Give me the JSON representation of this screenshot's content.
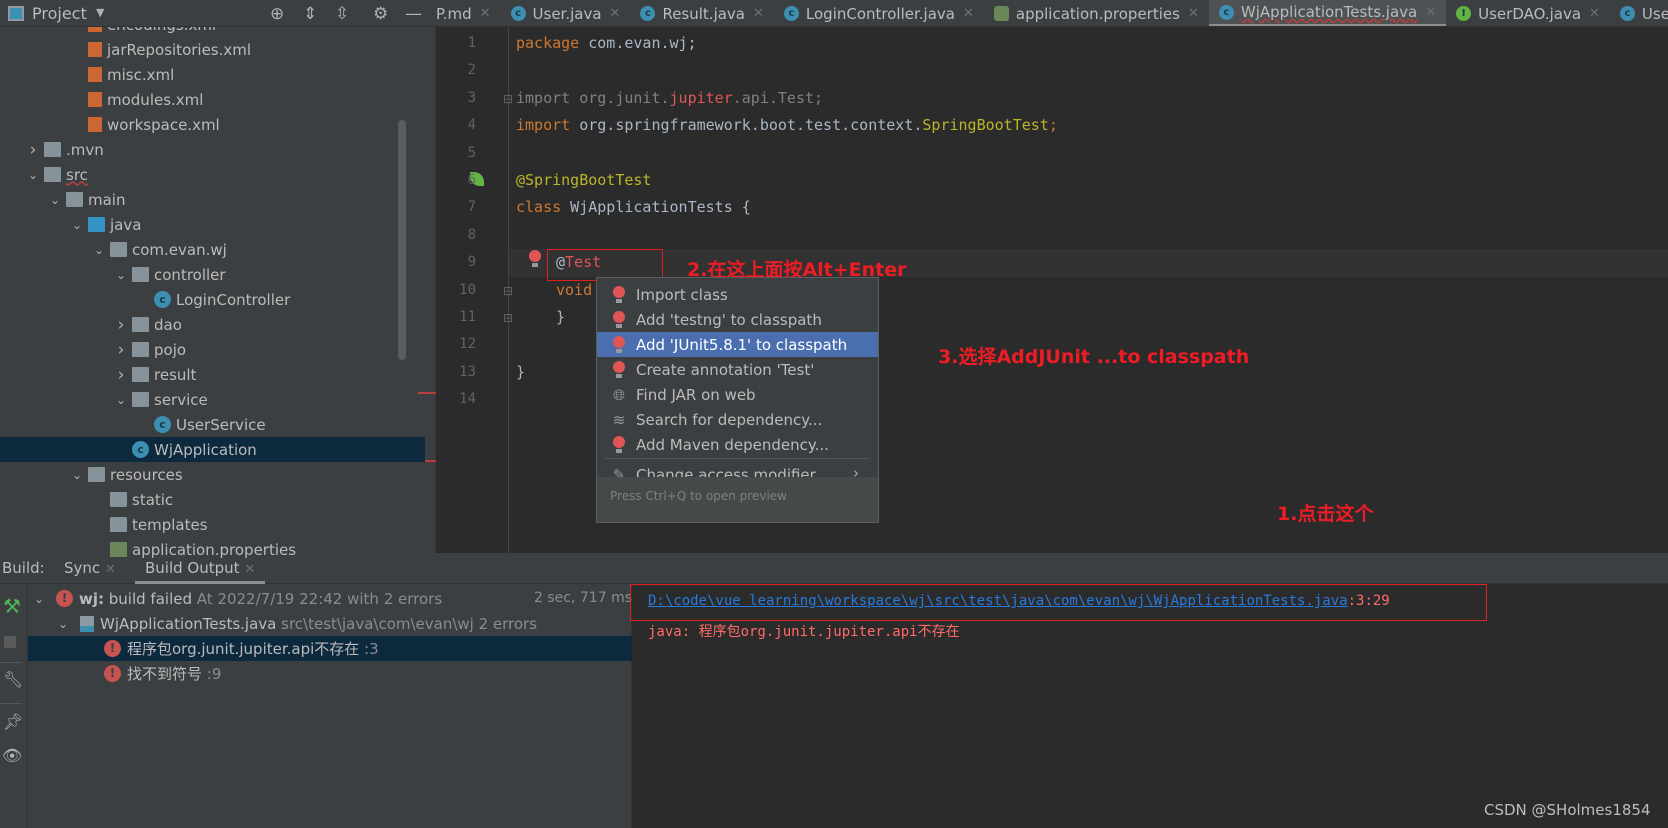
{
  "project_panel": {
    "title": "Project",
    "tree": [
      {
        "label": "encodings.xml",
        "depth": 3,
        "icon": "xml-file-icon"
      },
      {
        "label": "jarRepositories.xml",
        "depth": 3,
        "icon": "xml-file-icon"
      },
      {
        "label": "misc.xml",
        "depth": 3,
        "icon": "xml-file-icon"
      },
      {
        "label": "modules.xml",
        "depth": 3,
        "icon": "xml-file-icon"
      },
      {
        "label": "workspace.xml",
        "depth": 3,
        "icon": "xml-file-icon"
      },
      {
        "label": ".mvn",
        "depth": 1,
        "icon": "folder-icon",
        "chevron": "right"
      },
      {
        "label": "src",
        "depth": 1,
        "icon": "folder-icon",
        "chevron": "down"
      },
      {
        "label": "main",
        "depth": 2,
        "icon": "folder-icon",
        "chevron": "down"
      },
      {
        "label": "java",
        "depth": 3,
        "icon": "source-folder-icon",
        "chevron": "down"
      },
      {
        "label": "com.evan.wj",
        "depth": 4,
        "icon": "package-icon",
        "chevron": "down"
      },
      {
        "label": "controller",
        "depth": 5,
        "icon": "package-icon",
        "chevron": "down"
      },
      {
        "label": "LoginController",
        "depth": 6,
        "icon": "class-icon"
      },
      {
        "label": "dao",
        "depth": 5,
        "icon": "package-icon",
        "chevron": "right"
      },
      {
        "label": "pojo",
        "depth": 5,
        "icon": "package-icon",
        "chevron": "right"
      },
      {
        "label": "result",
        "depth": 5,
        "icon": "package-icon",
        "chevron": "right"
      },
      {
        "label": "service",
        "depth": 5,
        "icon": "package-icon",
        "chevron": "down"
      },
      {
        "label": "UserService",
        "depth": 6,
        "icon": "class-icon"
      },
      {
        "label": "WjApplication",
        "depth": 5,
        "icon": "spring-app-class-icon",
        "selected": true
      },
      {
        "label": "resources",
        "depth": 3,
        "icon": "resources-folder-icon",
        "chevron": "down"
      },
      {
        "label": "static",
        "depth": 4,
        "icon": "folder-icon"
      },
      {
        "label": "templates",
        "depth": 4,
        "icon": "folder-icon"
      },
      {
        "label": "application.properties",
        "depth": 4,
        "icon": "properties-file-icon"
      }
    ]
  },
  "editor_tabs": [
    {
      "label": "P.md",
      "icon": "markdown-icon"
    },
    {
      "label": "User.java",
      "icon": "class-icon"
    },
    {
      "label": "Result.java",
      "icon": "class-icon"
    },
    {
      "label": "LoginController.java",
      "icon": "class-icon"
    },
    {
      "label": "application.properties",
      "icon": "spring-properties-icon"
    },
    {
      "label": "WjApplicationTests.java",
      "icon": "class-icon",
      "active": true
    },
    {
      "label": "UserDAO.java",
      "icon": "interface-icon"
    },
    {
      "label": "Use",
      "icon": "class-icon"
    }
  ],
  "code": {
    "line_numbers": [
      "1",
      "2",
      "3",
      "4",
      "5",
      "6",
      "7",
      "8",
      "9",
      "10",
      "11",
      "12",
      "13",
      "14"
    ],
    "l1_kw": "package",
    "l1_rest": " com.evan.wj;",
    "l3_kw": "import",
    "l3_a": " org.junit.",
    "l3_red": "jupiter",
    "l3_b": ".api.Test;",
    "l4_kw": "import",
    "l4_a": " org.springframework.boot.test.context.",
    "l4_an": "SpringBootTest",
    "l4_semi": ";",
    "l6": "@SpringBootTest",
    "l7_kw": "class",
    "l7_rest": " WjApplicationTests {",
    "l9_at": "@",
    "l9_red": "Test",
    "l10": "void",
    "l11": "}",
    "l13": "}"
  },
  "annotations": {
    "step1": "1.点击这个",
    "step2": "2.在这上面按Alt+Enter",
    "step3": "3.选择AddJUnit ...to classpath",
    "color": "#ee1c24"
  },
  "intention_popup": {
    "items": [
      {
        "label": "Import class",
        "icon": "error-bulb-icon"
      },
      {
        "label": "Add 'testng' to classpath",
        "icon": "error-bulb-icon"
      },
      {
        "label": "Add 'JUnit5.8.1' to classpath",
        "icon": "error-bulb-icon",
        "selected": true
      },
      {
        "label": "Create annotation 'Test'",
        "icon": "error-bulb-icon"
      },
      {
        "label": "Find JAR on web",
        "icon": "globe-icon"
      },
      {
        "label": "Search for dependency...",
        "icon": "layers-icon"
      },
      {
        "label": "Add Maven dependency...",
        "icon": "error-bulb-icon"
      }
    ],
    "submenu_item": "Change access modifier",
    "footer": "Press Ctrl+Q to open preview"
  },
  "build_panel": {
    "label": "Build:",
    "tabs": [
      "Sync",
      "Build Output"
    ],
    "active_tab": "Build Output",
    "root": {
      "name": "wj:",
      "status": "build failed",
      "detail": "At 2022/7/19 22:42 with 2 errors",
      "duration": "2 sec, 717 ms"
    },
    "file": {
      "name": "WjApplicationTests.java",
      "path": "src\\test\\java\\com\\evan\\wj 2 errors"
    },
    "errors": [
      {
        "message": "程序包org.junit.jupiter.api不存在",
        "line": ":3"
      },
      {
        "message": "找不到符号",
        "line": ":9"
      }
    ],
    "console": {
      "link": "D:\\code\\vue learning\\workspace\\wj\\src\\test\\java\\com\\evan\\wj\\WjApplicationTests.java",
      "position": ":3:29",
      "error_line": "java: 程序包org.junit.jupiter.api不存在"
    }
  },
  "watermark": "CSDN @SHolmes1854",
  "colors": {
    "editor_bg": "#2b2b2b",
    "panel_bg": "#3c3f41",
    "selection": "#0d293e",
    "popup_selected": "#4b6eaf",
    "link": "#287bde",
    "error": "#c75450"
  }
}
